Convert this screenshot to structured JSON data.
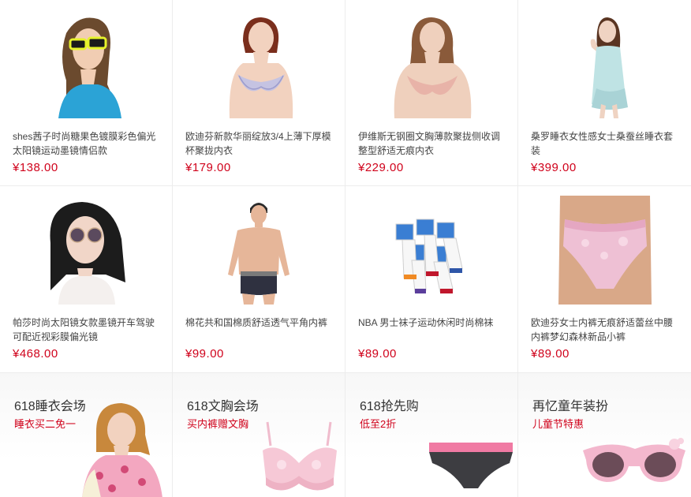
{
  "products": [
    {
      "name": "shes茜子时尚糖果色镀膜彩色偏光太阳镜运动墨镜情侣款",
      "price": "¥138.00",
      "icon": "sunglasses-model-photo"
    },
    {
      "name": "欧迪芬新款华丽绽放3/4上薄下厚模杯聚拢内衣",
      "price": "¥179.00",
      "icon": "bra-model-photo"
    },
    {
      "name": "伊维斯无钢圈文胸薄款聚拢侧收调整型舒适无痕内衣",
      "price": "¥229.00",
      "icon": "bra-model-photo"
    },
    {
      "name": "桑罗睡衣女性感女士桑蚕丝睡衣套装",
      "price": "¥399.00",
      "icon": "sleepwear-model-photo"
    },
    {
      "name": "帕莎时尚太阳镜女款墨镜开车驾驶可配近视彩膜偏光镜",
      "price": "¥468.00",
      "icon": "sunglasses-model-photo"
    },
    {
      "name": "棉花共和国棉质舒适透气平角内裤",
      "price": "¥99.00",
      "icon": "boxer-model-photo"
    },
    {
      "name": "NBA 男士袜子运动休闲时尚棉袜",
      "price": "¥89.00",
      "icon": "socks-photo"
    },
    {
      "name": "欧迪芬女士内裤无痕舒适蕾丝中腰内裤梦幻森林新品小裤",
      "price": "¥89.00",
      "icon": "panties-model-photo"
    }
  ],
  "promos": [
    {
      "title": "618睡衣会场",
      "subtitle": "睡衣买二免一",
      "icon": "pajamas-model-photo"
    },
    {
      "title": "618文胸会场",
      "subtitle": "买内裤赠文胸",
      "icon": "pink-bra-photo"
    },
    {
      "title": "618抢先购",
      "subtitle": "低至2折",
      "icon": "briefs-photo"
    },
    {
      "title": "再忆童年装扮",
      "subtitle": "儿童节特惠",
      "icon": "kids-sunglasses-photo"
    }
  ],
  "colors": {
    "price": "#d0021b",
    "promo_sub": "#d0021b",
    "border": "#ececec"
  }
}
